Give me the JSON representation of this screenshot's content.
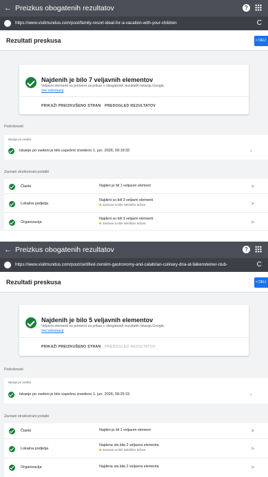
{
  "screens": [
    {
      "topbar": {
        "back_glyph": "←",
        "title": "Preizkus obogatenih rezultatov",
        "help_glyph": "?"
      },
      "urlbar": {
        "url": "https://www.visitmundus.com/post/family-resort-ideal-for-a-vacation-with-your-children",
        "reload_glyph": "C"
      },
      "header": {
        "title": "Rezultati preskusa",
        "share_label": "< DELI"
      },
      "summary": {
        "title": "Najdenih je bilo 7 veljavnih elementov",
        "description": "Veljavni elementi so primerni za prikaz v obogatenih rezultatih Iskanja Google.",
        "link": "Več informacij",
        "button_tested_page": "PRIKAŽI PREIZKUŠENO STRAN",
        "button_preview": "PREDOGLED REZULTATOV"
      },
      "details": {
        "section_label": "Podrobnosti",
        "crawl_label": "Iskanje po vsebini",
        "crawl_text": "Iskanje po vsebini je bilo uspešno izvedeno 1. jun. 2026, 09:19:32",
        "chevron": "⌄"
      },
      "structured": {
        "section_label": "Zaznani strukturirani podatki",
        "rows": [
          {
            "name": "Članki",
            "result": "Najden je bil 1 veljaven element",
            "warning": "",
            "chevron": ">"
          },
          {
            "name": "Lokalna podjetja",
            "result": "Najdeni so bili 3 veljavni elementi",
            "warning": "Zaznane so bile nekritične težave.",
            "chevron": ">"
          },
          {
            "name": "Organizacija",
            "result": "Najdeni so bili 3 veljavni elementi",
            "warning": "Zaznane so bile nekritične težave.",
            "chevron": ">"
          }
        ]
      }
    },
    {
      "topbar": {
        "back_glyph": "←",
        "title": "Preizkus obogatenih rezultatov",
        "help_glyph": "?"
      },
      "urlbar": {
        "url": "https://www.visitmundus.com/post/certified-zerokm-gastronomy-and-calabrian-culinary-dna-at-falkensteiner-club-",
        "reload_glyph": "C"
      },
      "header": {
        "title": "Rezultati preskusa",
        "share_label": "< DELI"
      },
      "summary": {
        "title": "Najdenih je bilo 5 veljavnih elementov",
        "description": "Veljavni elementi so primerni za prikaz v obogatenih rezultatih Iskanja Google.",
        "link": "Več informacij",
        "button_tested_page": "PRIKAŽI PREIZKUŠENO STRAN",
        "button_preview": "PREDOGLED REZULTATOV"
      },
      "details": {
        "section_label": "Podrobnosti",
        "crawl_label": "Iskanje po vsebini",
        "crawl_text": "Iskanje po vsebini je bilo uspešno izvedeno 1. jun. 2026, 09:25:15",
        "chevron": "⌄"
      },
      "structured": {
        "section_label": "Zaznani strukturirani podatki",
        "rows": [
          {
            "name": "Članki",
            "result": "Najden je bil 1 veljaven element",
            "warning": "",
            "chevron": ">"
          },
          {
            "name": "Lokalna podjetja",
            "result": "Najdena sta bila 2 veljavna elementa",
            "warning": "Zaznane so bile nekritične težave.",
            "chevron": ">"
          },
          {
            "name": "Organizacija",
            "result": "Najdena sta bila 2 veljavna elementa",
            "warning": "",
            "chevron": ">"
          }
        ]
      }
    }
  ],
  "colors": {
    "topbar": "#4a4f57",
    "urlbar": "#3c4046",
    "accent": "#1a73e8",
    "success": "#188038",
    "warning": "#f9ab00"
  }
}
